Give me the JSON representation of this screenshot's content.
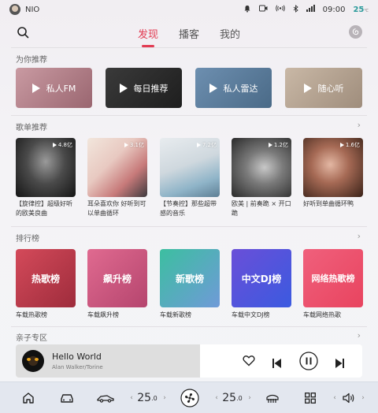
{
  "status": {
    "user": "NIO",
    "time": "09:00",
    "temp": "25",
    "temp_unit": "℃",
    "temp_sub": "PM2.5 13"
  },
  "nav": {
    "tabs": [
      "发现",
      "播客",
      "我的"
    ],
    "active_tab": "发现"
  },
  "sections": {
    "recommend": "为你推荐",
    "playlists": "歌单推荐",
    "charts": "排行榜",
    "kids": "亲子专区"
  },
  "recommend_cards": [
    {
      "label": "私人FM",
      "color": "#b07a80"
    },
    {
      "label": "每日推荐",
      "color": "#2c2c2c"
    },
    {
      "label": "私人雷达",
      "color": "#5a7a99"
    },
    {
      "label": "随心听",
      "color": "#b5a596"
    }
  ],
  "playlists": [
    {
      "count": "4.8亿",
      "text": "【旋律控】超级好听的欧美良曲"
    },
    {
      "count": "3.1亿",
      "text": "耳朵喜欢你 好听到可以单曲循环"
    },
    {
      "count": "7.2亿",
      "text": "【节奏控】那些超带感的音乐"
    },
    {
      "count": "1.2亿",
      "text": "欧美 | 前奏跪 × 开口跪"
    },
    {
      "count": "1.6亿",
      "text": "好听到单曲循环鸭"
    }
  ],
  "charts": [
    {
      "cover": "热歌榜",
      "label": "车载热歌榜"
    },
    {
      "cover": "飙升榜",
      "label": "车载飙升榜"
    },
    {
      "cover": "新歌榜",
      "label": "车载新歌榜"
    },
    {
      "cover": "中文DJ榜",
      "label": "车载中文DJ榜"
    },
    {
      "cover": "网络热歌榜",
      "label": "车载网络热歌"
    }
  ],
  "player": {
    "title": "Hello World",
    "artist": "Alan Walker/Torine"
  },
  "bottom": {
    "left_temp": "25",
    "right_temp": "25",
    "decimal": ".0"
  }
}
